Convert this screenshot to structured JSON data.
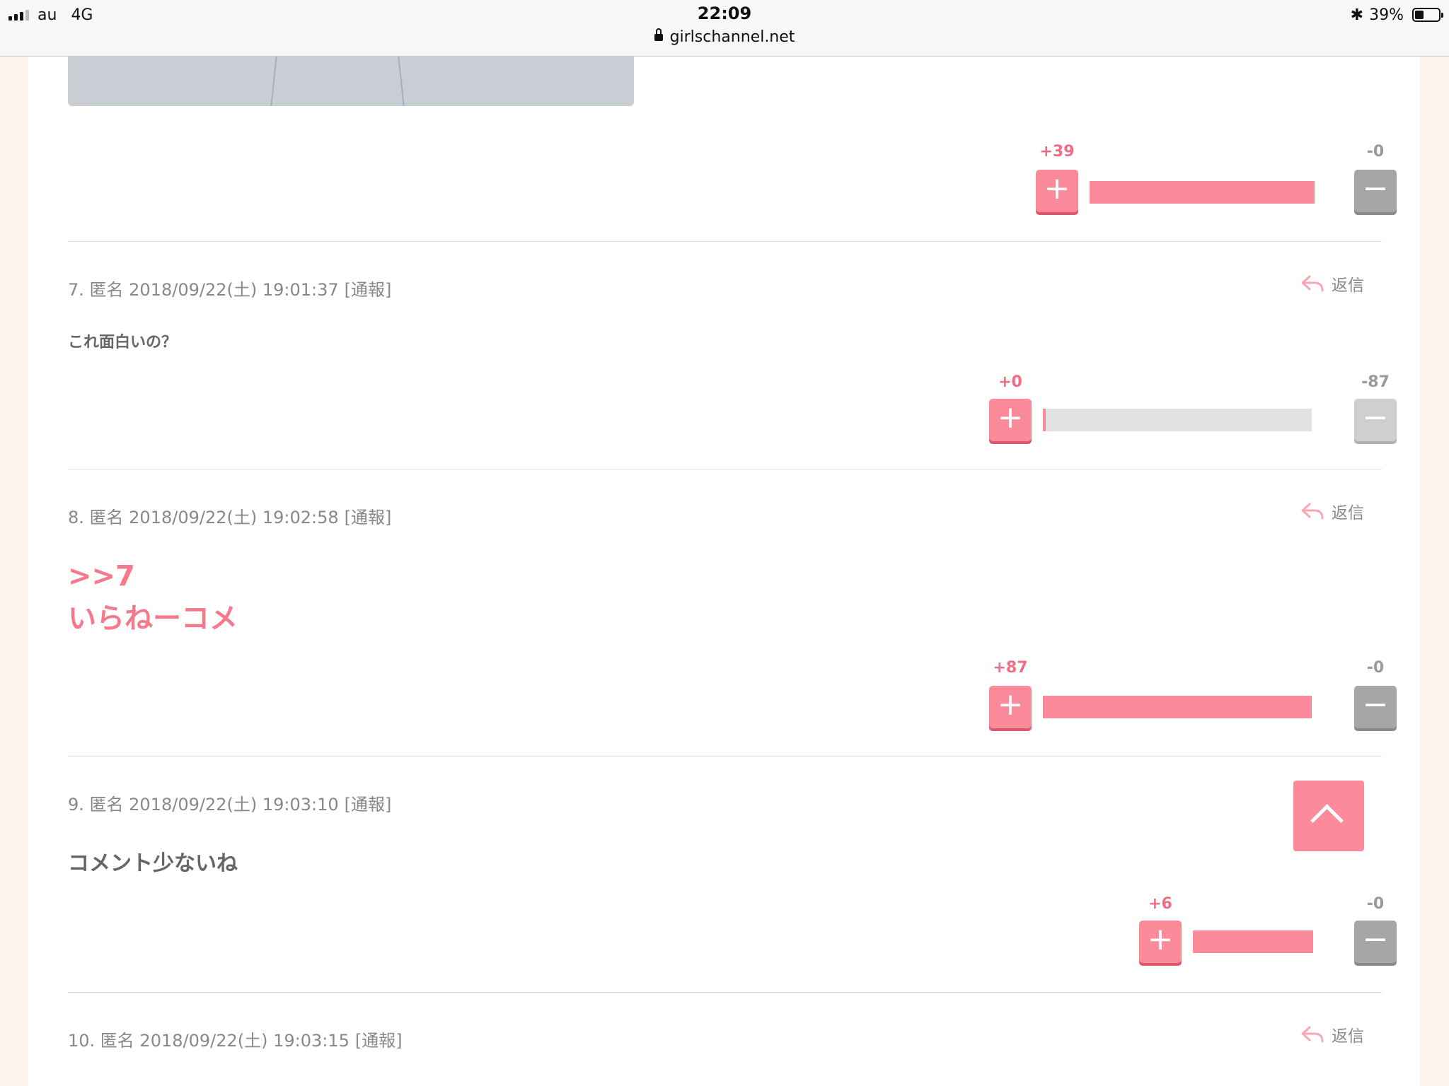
{
  "status_bar": {
    "carrier": "au",
    "network": "4G",
    "time": "22:09",
    "url": "girlschannel.net",
    "bluetooth": "✱",
    "battery_percent": "39%",
    "battery_level": 0.39
  },
  "comments_prev": {
    "vote": {
      "plus": "+39",
      "minus": "-0",
      "ratio": 1.0
    }
  },
  "comments": [
    {
      "meta": "7. 匿名 2018/09/22(土) 19:01:37",
      "report": "[通報]",
      "reply": "返信",
      "text": "これ面白いの？",
      "vote": {
        "plus": "+0",
        "minus": "-87",
        "ratio": 0.0
      }
    },
    {
      "meta": "8. 匿名 2018/09/22(土) 19:02:58",
      "report": "[通報]",
      "reply": "返信",
      "anchor": ">>7",
      "text": "いらねーコメ",
      "vote": {
        "plus": "+87",
        "minus": "-0",
        "ratio": 1.0
      }
    },
    {
      "meta": "9. 匿名 2018/09/22(土) 19:03:10",
      "report": "[通報]",
      "text": "コメント少ないね",
      "vote": {
        "plus": "+6",
        "minus": "-0",
        "ratio": 1.0
      }
    },
    {
      "meta": "10. 匿名 2018/09/22(土) 19:03:15",
      "report": "[通報]",
      "reply": "返信"
    }
  ],
  "icons": {
    "plus": "+",
    "minus": "−",
    "reply": "reply-arrow-icon",
    "scroll_top": "chevron-up-icon"
  },
  "colors": {
    "accent": "#fb8a9a",
    "plus_text": "#f26d83",
    "minus_button": "#a6a6a6"
  }
}
